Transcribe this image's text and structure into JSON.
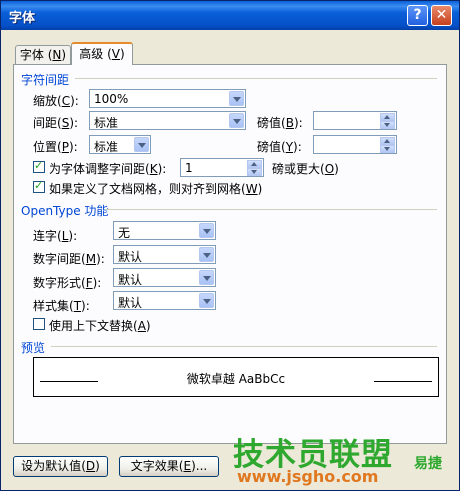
{
  "window": {
    "title": "字体",
    "help_glyph": "?",
    "close_glyph": "✕"
  },
  "tabs": [
    {
      "label": "字体",
      "key": "N"
    },
    {
      "label": "高级",
      "key": "V"
    }
  ],
  "spacing": {
    "group_label": "字符间距",
    "scale": {
      "label": "缩放",
      "key": "C",
      "value": "100%"
    },
    "spacing": {
      "label": "间距",
      "key": "S",
      "value": "标准"
    },
    "spacing_pt": {
      "label": "磅值",
      "key": "B",
      "value": ""
    },
    "position": {
      "label": "位置",
      "key": "P",
      "value": "标准"
    },
    "position_pt": {
      "label": "磅值",
      "key": "Y",
      "value": ""
    },
    "kerning": {
      "label": "为字体调整字间距",
      "key": "K",
      "value": "1",
      "suffix": "磅或更大",
      "suffix_key": "O",
      "checked": true
    },
    "snap_grid": {
      "label": "如果定义了文档网格，则对齐到网格",
      "key": "W",
      "checked": true
    }
  },
  "opentype": {
    "group_label": "OpenType 功能",
    "ligatures": {
      "label": "连字",
      "key": "L",
      "value": "无"
    },
    "number_spacing": {
      "label": "数字间距",
      "key": "M",
      "value": "默认"
    },
    "number_forms": {
      "label": "数字形式",
      "key": "F",
      "value": "默认"
    },
    "stylistic_sets": {
      "label": "样式集",
      "key": "T",
      "value": "默认"
    },
    "contextual_alternates": {
      "label": "使用上下文替换",
      "key": "A",
      "checked": false
    }
  },
  "preview": {
    "group_label": "预览",
    "sample": "微软卓越 AaBbCc"
  },
  "buttons": {
    "set_default": {
      "label": "设为默认值",
      "key": "D"
    },
    "text_effects": {
      "label": "文字效果",
      "key": "E",
      "ellipsis": "..."
    }
  },
  "watermark": {
    "line1": "技术员联盟",
    "line2": "www.jsgho.com",
    "line3": "易捷"
  },
  "colors": {
    "title_bar": "#0a5fd8",
    "dialog_bg": "#ece9d8",
    "group_label": "#0046d5",
    "watermark": "#2ea82e"
  }
}
